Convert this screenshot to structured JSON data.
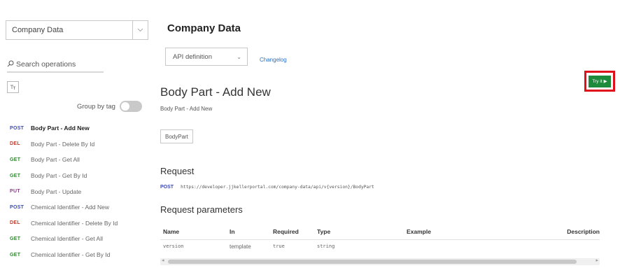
{
  "sidebar": {
    "api_select_value": "Company Data",
    "search_placeholder": "Search operations",
    "group_by_label": "Group by tag",
    "operations": [
      {
        "method": "POST",
        "name": "Body Part - Add New",
        "active": true
      },
      {
        "method": "DEL",
        "name": "Body Part - Delete By Id"
      },
      {
        "method": "GET",
        "name": "Body Part - Get All"
      },
      {
        "method": "GET",
        "name": "Body Part - Get By Id"
      },
      {
        "method": "PUT",
        "name": "Body Part - Update"
      },
      {
        "method": "POST",
        "name": "Chemical Identifier - Add New"
      },
      {
        "method": "DEL",
        "name": "Chemical Identifier - Delete By Id"
      },
      {
        "method": "GET",
        "name": "Chemical Identifier - Get All"
      },
      {
        "method": "GET",
        "name": "Chemical Identifier - Get By Id"
      }
    ]
  },
  "main": {
    "title": "Company Data",
    "definition_select": "API definition",
    "changelog": "Changelog",
    "try_it": "Try it",
    "operation_title": "Body Part - Add New",
    "operation_subtitle": "Body Part - Add New",
    "tag": "BodyPart",
    "request_heading": "Request",
    "request_method": "POST",
    "request_url": "https://developer.jjkellerportal.com/company-data/api/v{version}/BodyPart",
    "params_heading": "Request parameters",
    "table": {
      "headers": [
        "Name",
        "In",
        "Required",
        "Type",
        "Example",
        "Description"
      ],
      "rows": [
        [
          "version",
          "template",
          "true",
          "string",
          "",
          ""
        ]
      ]
    }
  },
  "colors": {
    "post": "#3b48b6",
    "del": "#c0392b",
    "get": "#2d8a2d",
    "put": "#8e3c8e",
    "try_it_bg": "#1e8a3c",
    "highlight": "#e0101a",
    "link": "#2a6fc0"
  }
}
